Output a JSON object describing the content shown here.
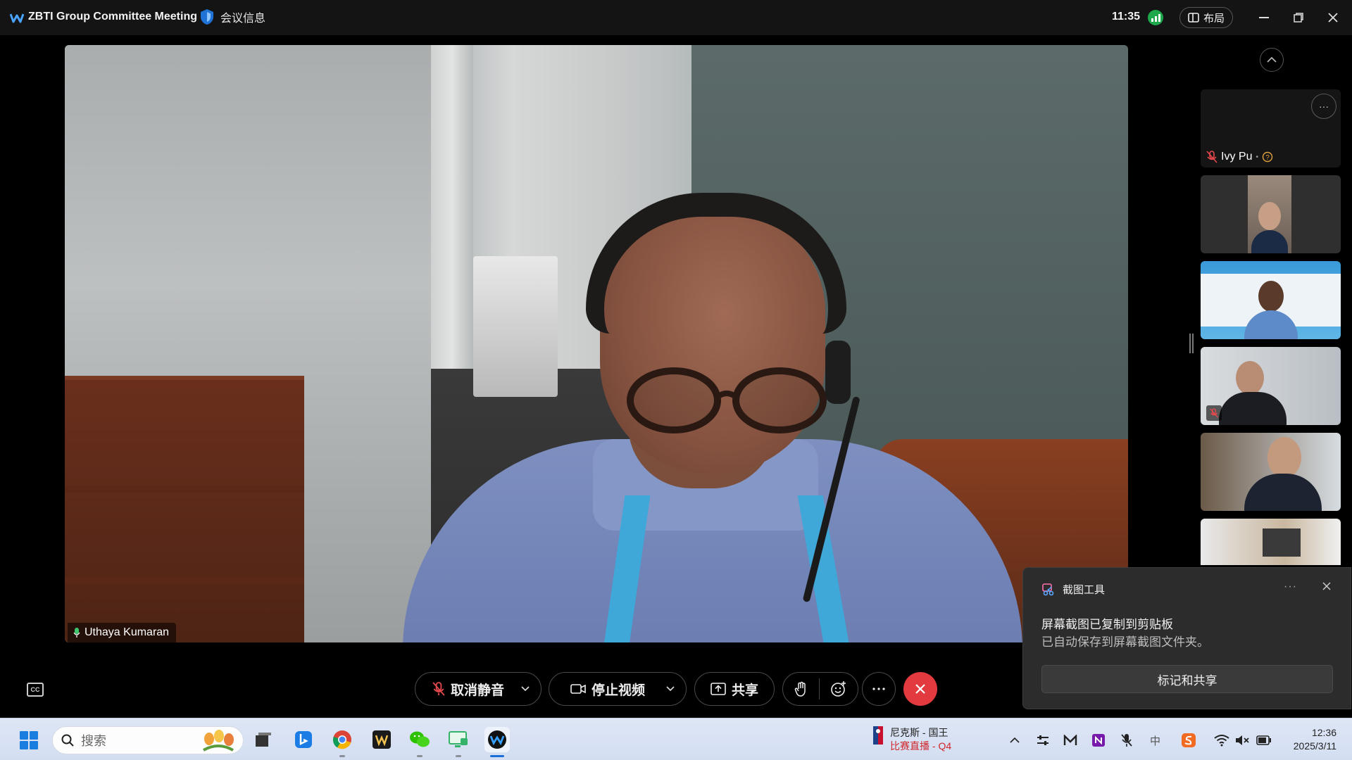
{
  "titlebar": {
    "app_title": "ZBTI Group Committee Meeting",
    "meeting_info_label": "会议信息",
    "clock": "11:35",
    "layout_label": "布局"
  },
  "main_video": {
    "speaker_name": "Uthaya Kumaran"
  },
  "participants": [
    {
      "name": "Ivy Pu",
      "muted": true,
      "video": false
    },
    {
      "name": "",
      "muted": false,
      "video": true
    },
    {
      "name": "",
      "muted": false,
      "video": true
    },
    {
      "name": "",
      "muted": true,
      "video": true
    },
    {
      "name": "",
      "muted": false,
      "video": true
    },
    {
      "name": "",
      "muted": false,
      "video": true
    }
  ],
  "controls": {
    "unmute_label": "取消静音",
    "stop_video_label": "停止视频",
    "share_label": "共享"
  },
  "toast": {
    "app_name": "截图工具",
    "title": "屏幕截图已复制到剪贴板",
    "body": "已自动保存到屏幕截图文件夹。",
    "button_label": "标记和共享"
  },
  "taskbar": {
    "search_placeholder": "搜索",
    "news_line1": "尼克斯 - 国王",
    "news_line2": "比赛直播 - Q4",
    "time": "12:36",
    "date": "2025/3/11"
  },
  "colors": {
    "leave_red": "#e23a3e",
    "signal_green": "#1da84b",
    "webex_blue": "#1a7ee0",
    "news_red": "#d0262b"
  }
}
